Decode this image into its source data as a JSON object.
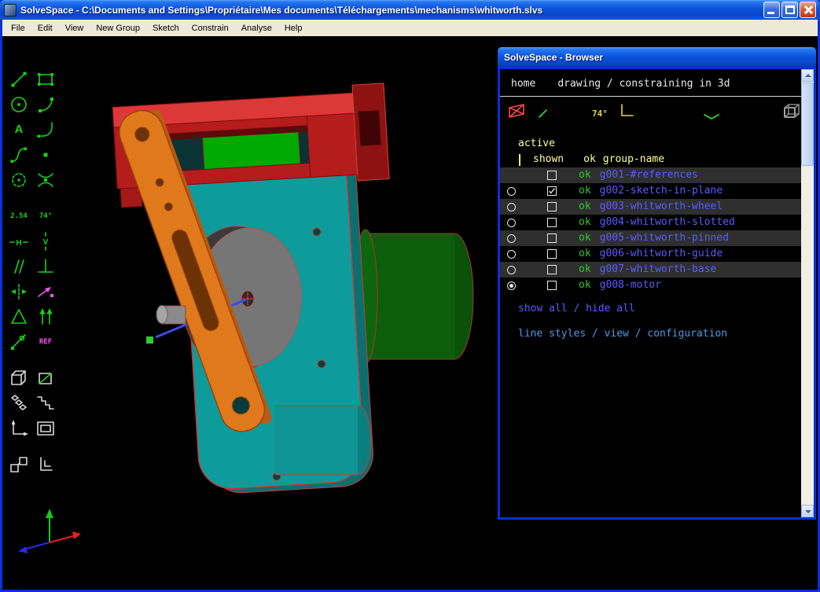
{
  "window": {
    "title": "SolveSpace - C:\\Documents and Settings\\Propriétaire\\Mes documents\\Téléchargements\\mechanisms\\whitworth.slvs"
  },
  "menu": {
    "items": [
      "File",
      "Edit",
      "View",
      "New Group",
      "Sketch",
      "Constrain",
      "Analyse",
      "Help"
    ]
  },
  "toolbar": {
    "text_tool_label": "A",
    "distance_label": "2.54",
    "angle_label": "74°",
    "horizontal_label": "H",
    "vertical_label": "V",
    "ref_label": "REF"
  },
  "browser": {
    "title": "SolveSpace - Browser",
    "nav_home": "home",
    "nav_path": "drawing / constraining in 3d",
    "toolbar_angle_label": "74°",
    "section_label": "active",
    "header": {
      "shown": "shown",
      "ok": "ok",
      "name": "group-name"
    },
    "rows": [
      {
        "ok": "ok",
        "name": "g001-#references"
      },
      {
        "ok": "ok",
        "name": "g002-sketch-in-plane"
      },
      {
        "ok": "ok",
        "name": "g003-whitworth-wheel"
      },
      {
        "ok": "ok",
        "name": "g004-whitworth-slotted"
      },
      {
        "ok": "ok",
        "name": "g005-whitworth-pinned"
      },
      {
        "ok": "ok",
        "name": "g006-whitworth-guide"
      },
      {
        "ok": "ok",
        "name": "g007-whitworth-base"
      },
      {
        "ok": "ok",
        "name": "g008-motor"
      }
    ],
    "links": {
      "show_all": "show all",
      "sep": "/",
      "hide_all": "hide all",
      "line_styles": "line styles",
      "view": "view",
      "configuration": "configuration"
    }
  },
  "colors": {
    "group_link_blue": "#5b5bff",
    "ok_green": "#2ec82e",
    "section_yellow": "#ffff9e",
    "config_link_cyan": "#4a9ae8",
    "plate_teal": "#0e9b9b",
    "arm_orange": "#e0781c",
    "rail_red": "#b51c1c",
    "motor_green": "#0c5e0c",
    "disc_gray": "#767676"
  }
}
